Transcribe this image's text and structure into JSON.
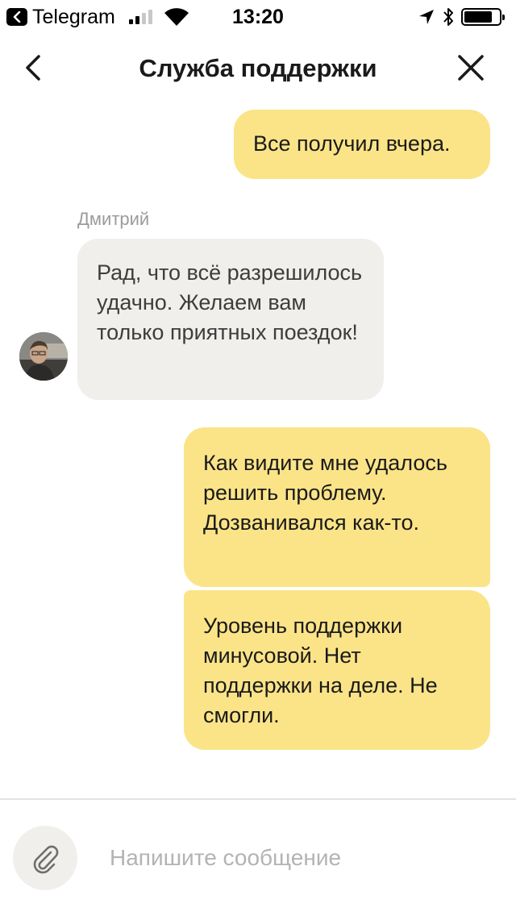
{
  "status_bar": {
    "back_app": "Telegram",
    "time": "13:20",
    "signal_bars": 2,
    "signal_total": 4,
    "battery_level": 0.8
  },
  "header": {
    "title": "Служба поддержки"
  },
  "messages": [
    {
      "direction": "outgoing",
      "text": "Все получил вчера."
    },
    {
      "direction": "incoming",
      "sender": "Дмитрий",
      "text": "Рад, что всё разрешилось удачно. Желаем вам только приятных поездок!"
    },
    {
      "direction": "outgoing",
      "text": "Как видите мне удалось решить проблему. Дозванивался как-то."
    },
    {
      "direction": "outgoing",
      "text": "Уровень поддержки минусовой. Нет поддержки на деле. Не смогли."
    }
  ],
  "composer": {
    "placeholder": "Напишите сообщение",
    "value": ""
  },
  "colors": {
    "outgoing_bubble": "#fbe488",
    "incoming_bubble": "#f1efec",
    "sender_name": "#9b9b9b",
    "placeholder": "#b3b3b3"
  }
}
